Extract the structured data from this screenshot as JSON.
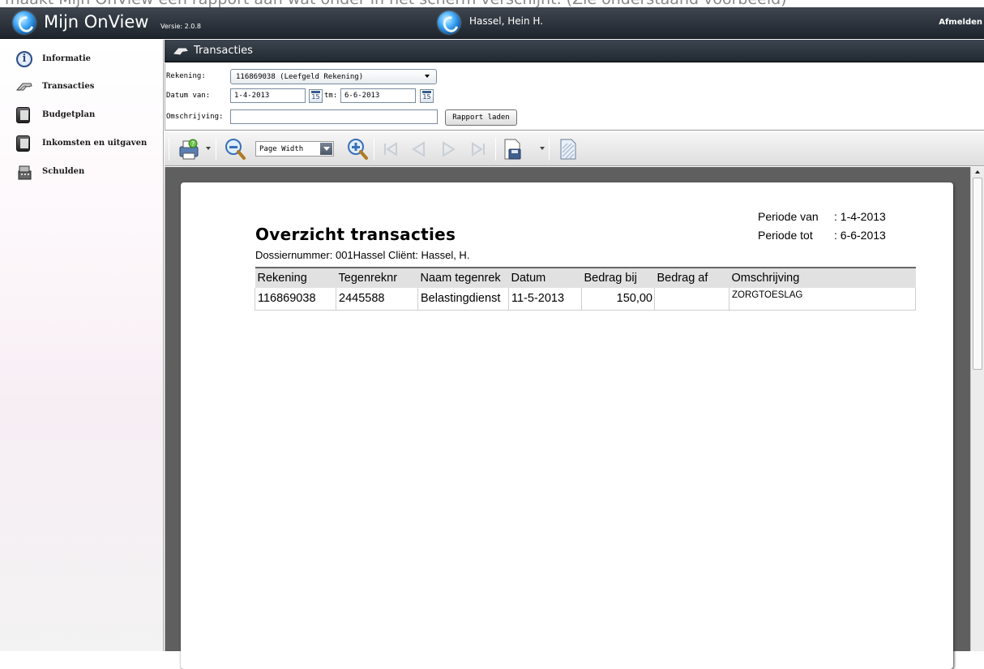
{
  "caption": "maakt Mijn OnView een rapport aan wat onder in het scherm verschijnt.  (Zie onderstaand voorbeeld)",
  "topbar": {
    "app_title": "Mijn OnView",
    "version": "Versie: 2.0.8",
    "user_name": "Hassel, Hein H.",
    "logout_label": "Afmelden"
  },
  "sidebar": {
    "items": [
      {
        "label": "Informatie",
        "icon": "info-icon"
      },
      {
        "label": "Transacties",
        "icon": "hand-icon"
      },
      {
        "label": "Budgetplan",
        "icon": "book-icon"
      },
      {
        "label": "Inkomsten en uitgaven",
        "icon": "book-icon"
      },
      {
        "label": "Schulden",
        "icon": "stack-icon"
      }
    ]
  },
  "main": {
    "header_title": "Transacties"
  },
  "form": {
    "rekening_label": "Rekening:",
    "rekening_value": "116869038 (Leefgeld Rekening)",
    "datum_van_label": "Datum van:",
    "datum_van_value": "1-4-2013",
    "tm_label": "tm:",
    "tm_value": "6-6-2013",
    "calendar_day": "15",
    "omschrijving_label": "Omschrijving:",
    "omschrijving_value": "",
    "load_button": "Rapport laden"
  },
  "toolbar": {
    "zoom_value": "Page Width"
  },
  "report": {
    "title": "Overzicht transacties",
    "subtitle": "Dossiernummer: 001Hassel   Cliënt: Hassel, H.",
    "period_from_label": "Periode van",
    "period_from_value": ": 1-4-2013",
    "period_to_label": "Periode tot",
    "period_to_value": ": 6-6-2013",
    "columns": [
      "Rekening",
      "Tegenreknr",
      "Naam tegenrek",
      "Datum",
      "Bedrag bij",
      "Bedrag af",
      "Omschrijving"
    ],
    "rows": [
      [
        "116869038",
        "2445588",
        "Belastingdienst",
        "11-5-2013",
        "150,00",
        "",
        "ZORGTOESLAG"
      ]
    ]
  },
  "colors": {
    "header_dark": "#2a323b",
    "viewer_bg": "#5f5f5f",
    "accent_blue": "#1f7ad8"
  }
}
